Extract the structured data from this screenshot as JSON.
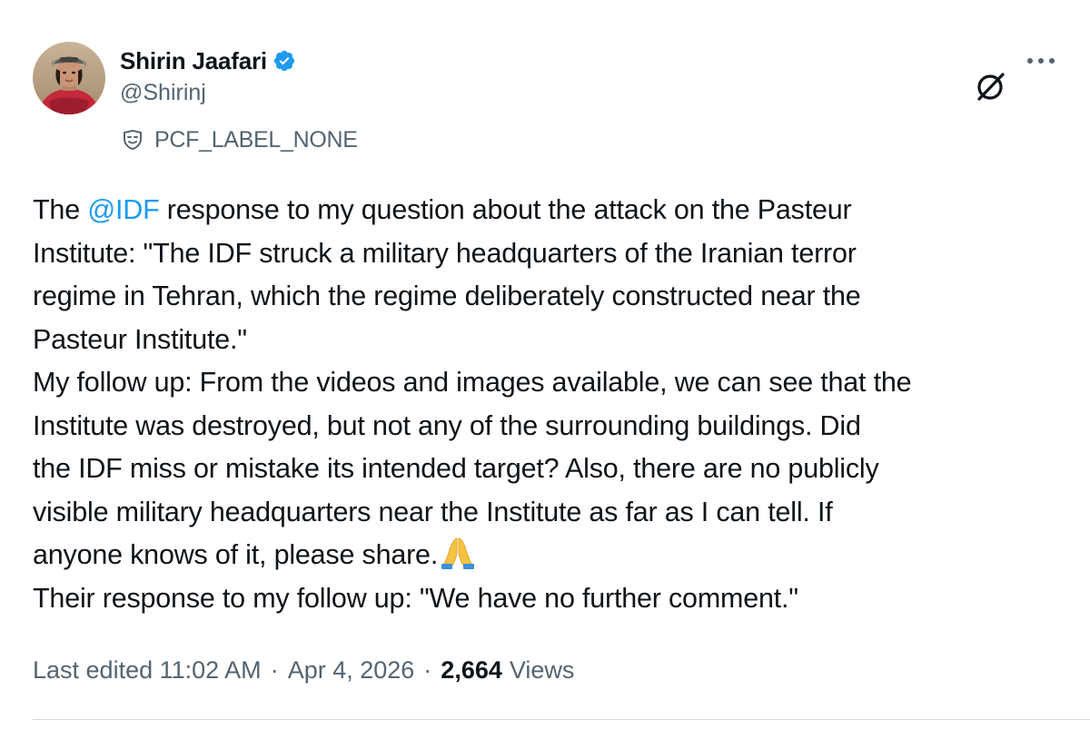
{
  "author": {
    "display_name": "Shirin Jaafari",
    "handle": "@Shirinj",
    "verified_icon": "verified-badge-icon",
    "label_icon": "mask-icon",
    "label": "PCF_LABEL_NONE"
  },
  "actions": {
    "grok_icon": "grok-icon",
    "more_icon": "more-options-icon"
  },
  "tweet": {
    "line1_prefix": "The ",
    "line1_mention": "@IDF",
    "line1_suffix": " response to my question about the attack on the Pasteur",
    "line2": "Institute: \"The IDF struck a military headquarters of the Iranian terror",
    "line3": "regime in Tehran, which the regime deliberately constructed near the",
    "line4": "Pasteur Institute.\"",
    "line5": "My follow up: From the videos and images available, we can see that the",
    "line6": "Institute was destroyed, but not any of the surrounding buildings. Did",
    "line7": "the IDF miss or mistake its intended target? Also, there are no publicly",
    "line8": "visible military headquarters near the Institute as far as I can tell. If",
    "line9": "anyone knows of it, please share.",
    "emoji": "folded-hands-emoji",
    "line10": "Their response to my follow up: \"We have no further comment.\""
  },
  "meta": {
    "edited": "Last edited 11:02 AM",
    "separator": "·",
    "date": "Apr 4, 2026",
    "views_count": "2,664",
    "views_label": "Views"
  },
  "colors": {
    "mention": "#1d9bf0",
    "secondary_text": "#536471",
    "primary_text": "#0f1419",
    "verified": "#1d9bf0"
  }
}
